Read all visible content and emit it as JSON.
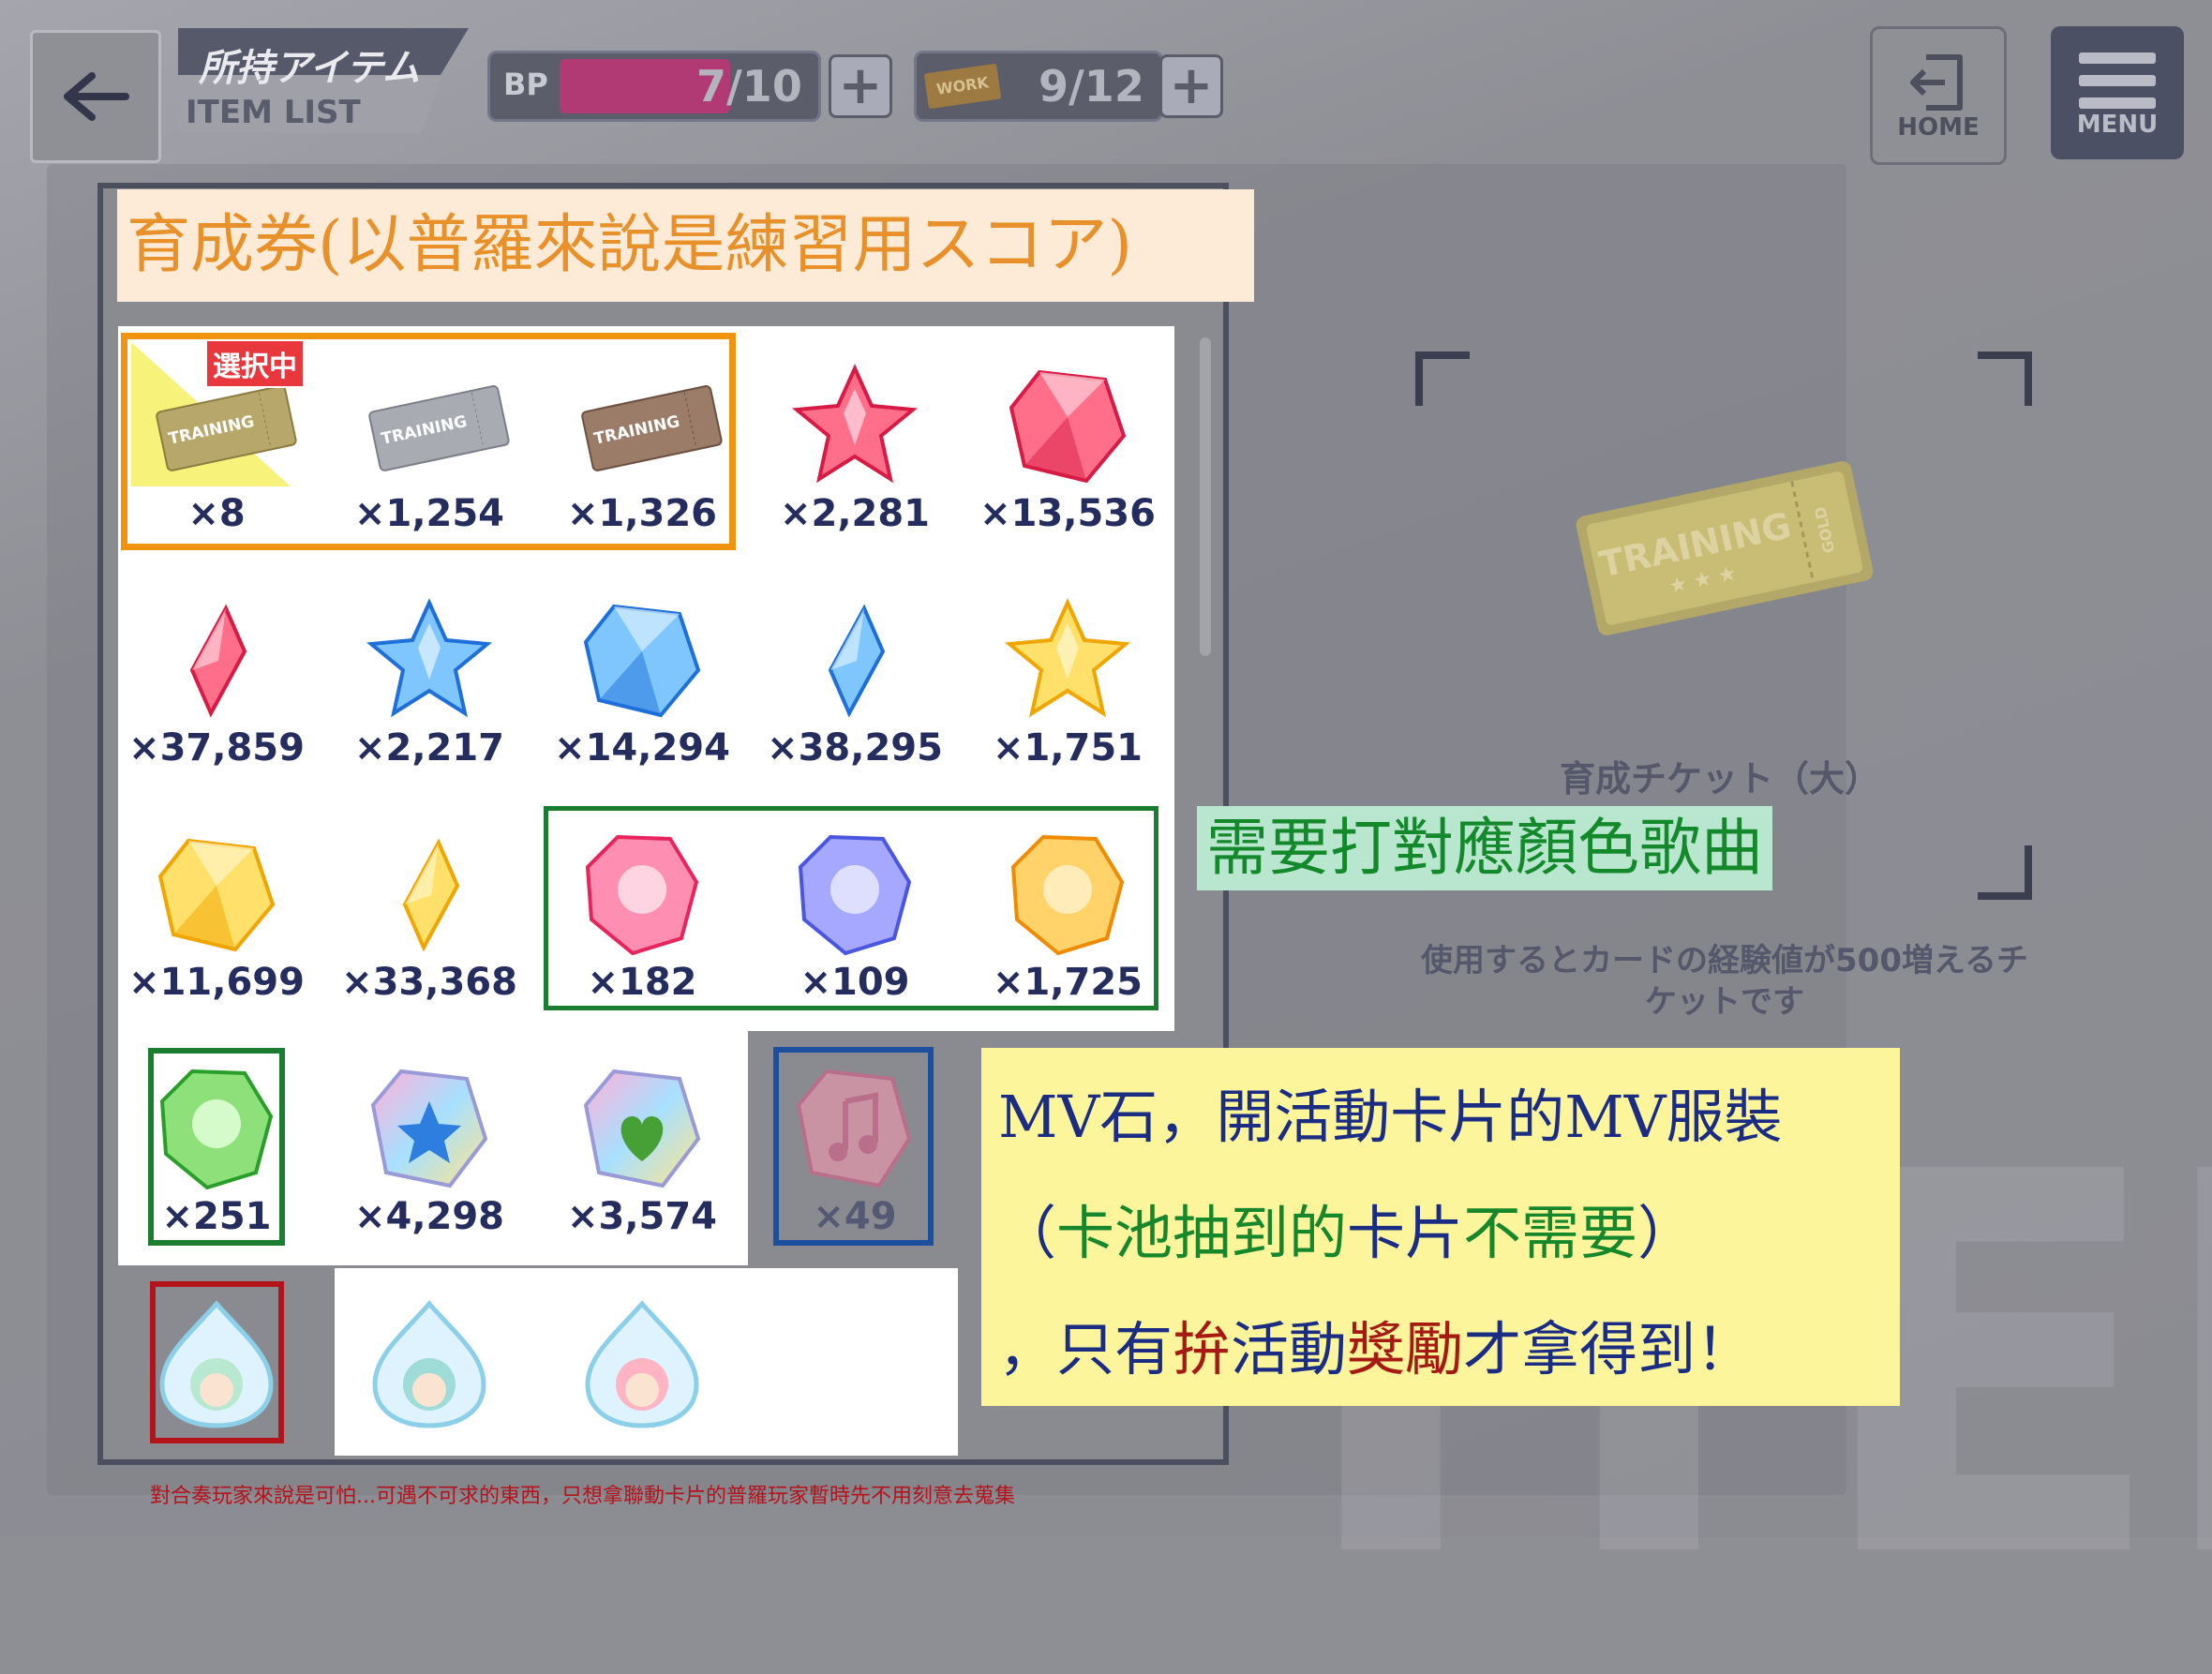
{
  "header": {
    "title_jp": "所持アイテム",
    "title_en": "ITEM LIST",
    "bp_label": "BP",
    "bp_value": "7/10",
    "bp_fill": 0.7,
    "work_label": "WORK",
    "work_value": "9/12",
    "work_fill": 0.75,
    "plus_symbol": "+",
    "home_label": "HOME",
    "menu_label": "MENU"
  },
  "annotations": {
    "top_banner": "育成券(以普羅來說是練習用スコア)",
    "green_label": "需要打對應顏色歌曲",
    "note_line1": "MV石，開活動卡片的MV服裝",
    "note_line2_a": "（",
    "note_line2_b": "卡池抽到的",
    "note_line2_c": "卡片",
    "note_line2_d": "不需要",
    "note_line2_e": "）",
    "note_line3_a": "，只有",
    "note_line3_b": "拚",
    "note_line3_c": "活動",
    "note_line3_d": "獎勵",
    "note_line3_e": "才拿得到！",
    "footer": "對合奏玩家來說是可怕...可遇不可求的東西，只想拿聯動卡片的普羅玩家暫時先不用刻意去蒐集",
    "colors": {
      "orange": "#f0930f",
      "green": "#1b7d2f",
      "blue": "#1e4e9e",
      "red": "#b2141a"
    }
  },
  "selected_badge": "選択中",
  "items": [
    {
      "icon": "gold-training-ticket-icon",
      "qty": "×8"
    },
    {
      "icon": "silver-training-ticket-icon",
      "qty": "×1,254"
    },
    {
      "icon": "bronze-training-ticket-icon",
      "qty": "×1,326"
    },
    {
      "icon": "red-star-crystal-icon",
      "qty": "×2,281"
    },
    {
      "icon": "red-gem-icon",
      "qty": "×13,536"
    },
    {
      "icon": "red-shard-icon",
      "qty": "×37,859"
    },
    {
      "icon": "blue-star-crystal-icon",
      "qty": "×2,217"
    },
    {
      "icon": "blue-gem-icon",
      "qty": "×14,294"
    },
    {
      "icon": "blue-shard-icon",
      "qty": "×38,295"
    },
    {
      "icon": "yellow-star-crystal-icon",
      "qty": "×1,751"
    },
    {
      "icon": "yellow-gem-icon",
      "qty": "×11,699"
    },
    {
      "icon": "yellow-shard-icon",
      "qty": "×33,368"
    },
    {
      "icon": "pink-song-gem-icon",
      "qty": "×182"
    },
    {
      "icon": "blue-song-gem-icon",
      "qty": "×109"
    },
    {
      "icon": "orange-song-gem-icon",
      "qty": "×1,725"
    },
    {
      "icon": "green-song-gem-icon",
      "qty": "×251"
    },
    {
      "icon": "rainbow-star-gem-icon",
      "qty": "×4,298"
    },
    {
      "icon": "rainbow-heart-gem-icon",
      "qty": "×3,574"
    },
    {
      "icon": "mv-music-stone-icon",
      "qty": "×49"
    },
    {
      "icon": "crown-medal-icon",
      "qty": ""
    },
    {
      "icon": "character-drop-1-icon",
      "qty": ""
    },
    {
      "icon": "character-drop-2-icon",
      "qty": ""
    },
    {
      "icon": "character-drop-3-icon",
      "qty": ""
    }
  ],
  "detail": {
    "name": "育成チケット（大）",
    "description": "使用するとカードの経験値が500増えるチケットです",
    "ticket_text": "TRAINING",
    "ticket_grade": "GOLD"
  },
  "watermark": "ITEM"
}
